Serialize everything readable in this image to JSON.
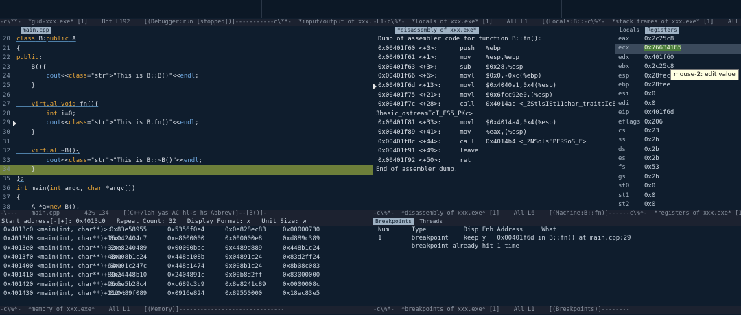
{
  "top_modelines": [
    "-c\\**-  *gud-xxx.exe* [1]    Bot L192    [(Debugger:run [stopped])]-----------c\\**-  *input/output of xxx.exe*   All",
    "-L1-c\\%*-  *locals of xxx.exe* [1]    All L1    [(Locals:B::-c\\%*-  *stack frames of xxx.exe* [1]    All L1    [(Fr"
  ],
  "source": {
    "tab": "main.cpp",
    "lines": [
      {
        "n": "20",
        "text": "class B:public A"
      },
      {
        "n": "21",
        "text": "{"
      },
      {
        "n": "22",
        "text": "public:"
      },
      {
        "n": "23",
        "text": "    B(){"
      },
      {
        "n": "24",
        "text": "        cout<<\"This is B::B()\"<<endl;"
      },
      {
        "n": "25",
        "text": "    }"
      },
      {
        "n": "26",
        "text": ""
      },
      {
        "n": "27",
        "text": "    virtual void fn(){"
      },
      {
        "n": "28",
        "text": "        int i=0;"
      },
      {
        "n": "29",
        "text": "        cout<<\"This is B.fn()\"<<endl;"
      },
      {
        "n": "30",
        "text": "    }"
      },
      {
        "n": "31",
        "text": ""
      },
      {
        "n": "32",
        "text": "    virtual ~B(){"
      },
      {
        "n": "33",
        "text": "        cout<<\"This is B::~B()\"<<endl;"
      },
      {
        "n": "34",
        "text": "    }"
      },
      {
        "n": "35",
        "text": "};"
      },
      {
        "n": "36",
        "text": "int main(int argc, char *argv[])"
      },
      {
        "n": "37",
        "text": "{"
      },
      {
        "n": "38",
        "text": "    A *a=new B(),"
      },
      {
        "n": "39",
        "text": "    a->fn();"
      }
    ],
    "modeline": "-\\---    main.cpp       42% L34    [(C++/lah yas AC hl-s hs Abbrev)]--[B()]-"
  },
  "disassembly": {
    "tab": "*disassembly of xxx.exe*",
    "header": "Dump of assembler code for function B::fn():",
    "lines": [
      "0x00401f60 <+0>:      push   %ebp",
      "0x00401f61 <+1>:      mov    %esp,%ebp",
      "0x00401f63 <+3>:      sub    $0x28,%esp",
      "0x00401f66 <+6>:      movl   $0x0,-0xc(%ebp)",
      "0x00401f6d <+13>:     movl   $0x4040a1,0x4(%esp)",
      "0x00401f75 <+21>:     movl   $0x6fcc92e0,(%esp)",
      "0x00401f7c <+28>:     call   0x4014ac <_ZStlsISt11char_traitsIcEERSt13",
      "3basic_ostreamIcT_ES5_PKc>",
      "0x00401f81 <+33>:     movl   $0x4014a4,0x4(%esp)",
      "0x00401f89 <+41>:     mov    %eax,(%esp)",
      "0x00401f8c <+44>:     call   0x4014b4 <_ZNSolsEPFRSoS_E>",
      "0x00401f91 <+49>:     leave",
      "0x00401f92 <+50>:     ret",
      "End of assembler dump."
    ],
    "modeline": "-c\\%*-  *disassembly of xxx.exe* [1]    All L6    [(Machine:B::fn)]------c\\%*-  *registers of xxx.exe* [1]"
  },
  "registers": {
    "tabs": [
      "Locals",
      "Registers"
    ],
    "rows": [
      [
        "eax",
        "0x2c25c8"
      ],
      [
        "ecx",
        "0x76634185"
      ],
      [
        "edx",
        "0x401f60"
      ],
      [
        "ebx",
        "0x2c25c8"
      ],
      [
        "esp",
        "0x28fec"
      ],
      [
        "ebp",
        "0x28fee"
      ],
      [
        "esi",
        "0x0"
      ],
      [
        "edi",
        "0x0"
      ],
      [
        "eip",
        "0x401f6d"
      ],
      [
        "eflags",
        "0x206"
      ],
      [
        "cs",
        "0x23"
      ],
      [
        "ss",
        "0x2b"
      ],
      [
        "ds",
        "0x2b"
      ],
      [
        "es",
        "0x2b"
      ],
      [
        "fs",
        "0x53"
      ],
      [
        "gs",
        "0x2b"
      ],
      [
        "st0",
        "0x0"
      ],
      [
        "st1",
        "0x0"
      ],
      [
        "st2",
        "0x0"
      ],
      [
        "st3",
        "0x0"
      ],
      [
        "st4",
        "0x0"
      ]
    ],
    "tooltip": "mouse-2: edit value"
  },
  "memory": {
    "header": "Start address[-|+]: 0x4013c0   Repeat Count: 32   Display Format: x   Unit Size: w",
    "rows": [
      [
        "0x4013c0 <main(int, char**)>:",
        "0x83e58955",
        "0x5356f0e4",
        "0x0e828ec83",
        "0x00000730"
      ],
      [
        "0x4013d0 <main(int, char**)+16>:",
        "0x042404c7",
        "0xe8000000",
        "0x000000e8",
        "0xd889c389"
      ],
      [
        "0x4013e0 <main(int, char**)+32>:",
        "0xe8240489",
        "0x00000bac",
        "0x4489d889",
        "0x448b1c24"
      ],
      [
        "0x4013f0 <main(int, char**)+48>:",
        "0x008b1c24",
        "0x448b108b",
        "0x04891c24",
        "0x83d2ff24"
      ],
      [
        "0x401400 <main(int, char**)+64>:",
        "0x001c247c",
        "0x448b1474",
        "0x008b1c24",
        "0x8b08c083"
      ],
      [
        "0x401410 <main(int, char**)+80>:",
        "0x24448b10",
        "0x2404891c",
        "0x00b8d2ff",
        "0x83000000"
      ],
      [
        "0x401420 <main(int, char**)+96>:",
        "0x5e5b28c4",
        "0xc689c3c9",
        "0x8e8241c89",
        "0x0000008c"
      ],
      [
        "0x401430 <main(int, char**)+112>:",
        "0x0489f089",
        "0x0916e824",
        "0x89550000",
        "0x18ec83e5"
      ]
    ],
    "modeline": "-c\\%*-  *memory of xxx.exe*    All L1    [(Memory)]------------------------------"
  },
  "breakpoints": {
    "tabs": [
      "Breakpoints",
      "Threads"
    ],
    "header": "Num      Type          Disp Enb Address     What",
    "rows": [
      "1        breakpoint    keep y   0x00401f6d in B::fn() at main.cpp:29",
      "         breakpoint already hit 1 time"
    ],
    "modeline": "-c\\%*-  *breakpoints of xxx.exe* [1]    All L1    [(Breakpoints)]--------"
  }
}
